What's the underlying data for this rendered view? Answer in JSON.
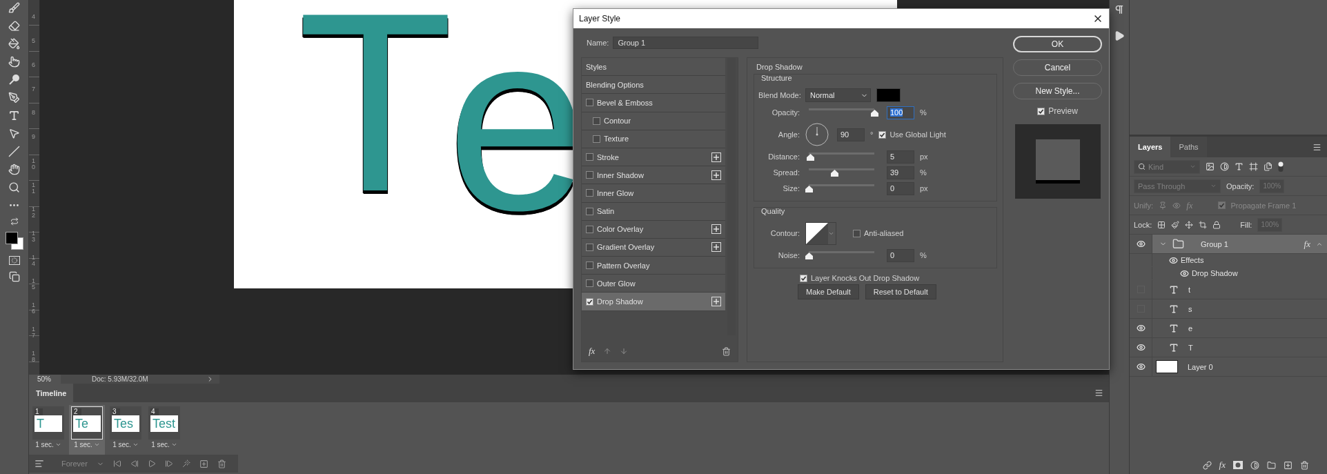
{
  "ruler": {
    "labels": [
      "4",
      "5",
      "6",
      "7",
      "8",
      "9",
      "10",
      "11",
      "12",
      "13",
      "14",
      "15",
      "16",
      "17",
      "18"
    ]
  },
  "canvas": {
    "glyphs": [
      {
        "text": "T"
      },
      {
        "text": "e"
      }
    ]
  },
  "status_bar": {
    "zoom": "50%",
    "doc": "Doc: 5.93M/32.0M"
  },
  "timeline": {
    "tab": "Timeline",
    "loop": "Forever",
    "frames": [
      {
        "number": "1",
        "thumb_text": "T",
        "delay": "1 sec.",
        "selected": false
      },
      {
        "number": "2",
        "thumb_text": "Te",
        "delay": "1 sec.",
        "selected": true
      },
      {
        "number": "3",
        "thumb_text": "Tes",
        "delay": "1 sec.",
        "selected": false
      },
      {
        "number": "4",
        "thumb_text": "Test",
        "delay": "1 sec.",
        "selected": false
      }
    ]
  },
  "layers_panel": {
    "tabs": [
      {
        "label": "Layers",
        "selected": true
      },
      {
        "label": "Paths",
        "selected": false
      }
    ],
    "filter": {
      "value": "Kind",
      "disabled": true
    },
    "blend": {
      "value": "Pass Through",
      "disabled": true,
      "opacity_label": "Opacity:",
      "opacity": "100%"
    },
    "unify": {
      "label": "Unify:",
      "fx": "fx",
      "propagate": {
        "label": "Propagate Frame 1",
        "checked": true
      }
    },
    "lock": {
      "label": "Lock:",
      "fill_label": "Fill:",
      "fill": "100%"
    },
    "layers": [
      {
        "name": "Group 1",
        "kind": "group",
        "visible": true,
        "selected": true,
        "expanded": true,
        "fx": "fx",
        "children": [
          {
            "name": "Effects",
            "visible": true,
            "children": [
              {
                "name": "Drop Shadow",
                "visible": true
              }
            ]
          }
        ]
      },
      {
        "name": "t",
        "kind": "type",
        "visible": false,
        "selected": false
      },
      {
        "name": "s",
        "kind": "type",
        "visible": false,
        "selected": false
      },
      {
        "name": "e",
        "kind": "type",
        "visible": true,
        "selected": false
      },
      {
        "name": "T",
        "kind": "type",
        "visible": true,
        "selected": false
      },
      {
        "name": "Layer 0",
        "kind": "pixel",
        "visible": true,
        "selected": false
      }
    ],
    "footer_fx": "fx"
  },
  "dialog": {
    "title": "Layer Style",
    "name_label": "Name:",
    "name_value": "Group 1",
    "styles": [
      {
        "label": "Styles",
        "kind": "header",
        "selected": false
      },
      {
        "label": "Blending Options",
        "kind": "header",
        "selected": false
      },
      {
        "label": "Bevel & Emboss",
        "kind": "effect",
        "checked": false,
        "addable": false,
        "selected": false,
        "children": [
          {
            "label": "Contour",
            "kind": "effect",
            "checked": false,
            "addable": false,
            "selected": false
          },
          {
            "label": "Texture",
            "kind": "effect",
            "checked": false,
            "addable": false,
            "selected": false
          }
        ]
      },
      {
        "label": "Stroke",
        "kind": "effect",
        "checked": false,
        "addable": true,
        "selected": false
      },
      {
        "label": "Inner Shadow",
        "kind": "effect",
        "checked": false,
        "addable": true,
        "selected": false
      },
      {
        "label": "Inner Glow",
        "kind": "effect",
        "checked": false,
        "addable": false,
        "selected": false
      },
      {
        "label": "Satin",
        "kind": "effect",
        "checked": false,
        "addable": false,
        "selected": false
      },
      {
        "label": "Color Overlay",
        "kind": "effect",
        "checked": false,
        "addable": true,
        "selected": false
      },
      {
        "label": "Gradient Overlay",
        "kind": "effect",
        "checked": false,
        "addable": true,
        "selected": false
      },
      {
        "label": "Pattern Overlay",
        "kind": "effect",
        "checked": false,
        "addable": false,
        "selected": false
      },
      {
        "label": "Outer Glow",
        "kind": "effect",
        "checked": false,
        "addable": false,
        "selected": false
      },
      {
        "label": "Drop Shadow",
        "kind": "effect",
        "checked": true,
        "addable": true,
        "selected": true
      }
    ],
    "list_fx": "fx",
    "section_title": "Drop Shadow",
    "structure": {
      "title": "Structure",
      "rows": [
        {
          "kind": "select",
          "label": "Blend Mode:",
          "value": "Normal"
        },
        {
          "kind": "slider",
          "label": "Opacity:",
          "level": 1,
          "value": "100",
          "unit": "%",
          "focused": true
        },
        {
          "kind": "angle",
          "label": "Angle:",
          "value": "90",
          "unit": "°",
          "checkbox": {
            "label": "Use Global Light",
            "checked": true
          }
        },
        {
          "kind": "slider",
          "label": "Distance:",
          "level": 0.02,
          "value": "5",
          "unit": "px",
          "focused": false
        },
        {
          "kind": "slider",
          "label": "Spread:",
          "level": 0.39,
          "value": "39",
          "unit": "%",
          "focused": false
        },
        {
          "kind": "slider",
          "label": "Size:",
          "level": 0,
          "value": "0",
          "unit": "px",
          "focused": false
        }
      ]
    },
    "quality": {
      "title": "Quality",
      "rows": [
        {
          "kind": "contour",
          "label": "Contour:",
          "checkbox": {
            "label": "Anti-aliased",
            "checked": false
          }
        },
        {
          "kind": "slider",
          "label": "Noise:",
          "level": 0,
          "value": "0",
          "unit": "%",
          "focused": false
        }
      ]
    },
    "knockout": {
      "label": "Layer Knocks Out Drop Shadow",
      "checked": true
    },
    "buttons": [
      "Make Default",
      "Reset to Default"
    ],
    "actions": [
      {
        "label": "OK",
        "default": true
      },
      {
        "label": "Cancel",
        "default": false
      },
      {
        "label": "New Style...",
        "default": false
      }
    ],
    "preview": {
      "label": "Preview",
      "checked": true
    }
  }
}
